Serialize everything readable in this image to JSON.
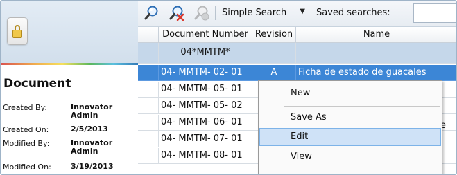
{
  "left_panel": {
    "title": "Document",
    "meta": [
      {
        "label": "Created By:",
        "value": "Innovator Admin"
      },
      {
        "label": "Created On:",
        "value": "2/5/2013"
      },
      {
        "label": "Modified By:",
        "value": "Innovator Admin"
      },
      {
        "label": "Modified On:",
        "value": "3/19/2013"
      }
    ],
    "icon": "locked-document-icon"
  },
  "toolbar": {
    "buttons": [
      {
        "name": "run-search-icon"
      },
      {
        "name": "clear-search-icon"
      },
      {
        "name": "stop-search-icon"
      }
    ],
    "search_mode": "Simple Search",
    "saved_searches_label": "Saved searches:",
    "saved_searches_value": ""
  },
  "grid": {
    "columns": [
      "",
      "Document Number",
      "Revision",
      "Name"
    ],
    "filter": {
      "document_number": "04*MMTM*",
      "revision": "",
      "name": ""
    },
    "rows": [
      {
        "document_number": "04- MMTM- 02- 01",
        "revision": "A",
        "name": "Ficha de estado de guacales",
        "selected": true
      },
      {
        "document_number": "04- MMTM- 05- 01",
        "revision": "",
        "name": "",
        "selected": false
      },
      {
        "document_number": "04- MMTM- 05- 02",
        "revision": "",
        "name": "",
        "selected": false
      },
      {
        "document_number": "04- MMTM- 06- 01",
        "revision": "",
        "name": "",
        "selected": false
      },
      {
        "document_number": "04- MMTM- 07- 01",
        "revision": "",
        "name": "",
        "selected": false
      },
      {
        "document_number": "04- MMTM- 08- 01",
        "revision": "",
        "name": "",
        "selected": false
      }
    ]
  },
  "context_menu": {
    "items": [
      "New",
      "Save As",
      "Edit",
      "View"
    ],
    "highlighted": "Edit"
  },
  "truncated_text": "e",
  "colors": {
    "selection": "#3c86d6",
    "filter_row": "#c5d7ea",
    "menu_highlight": "#cfe2f7"
  }
}
